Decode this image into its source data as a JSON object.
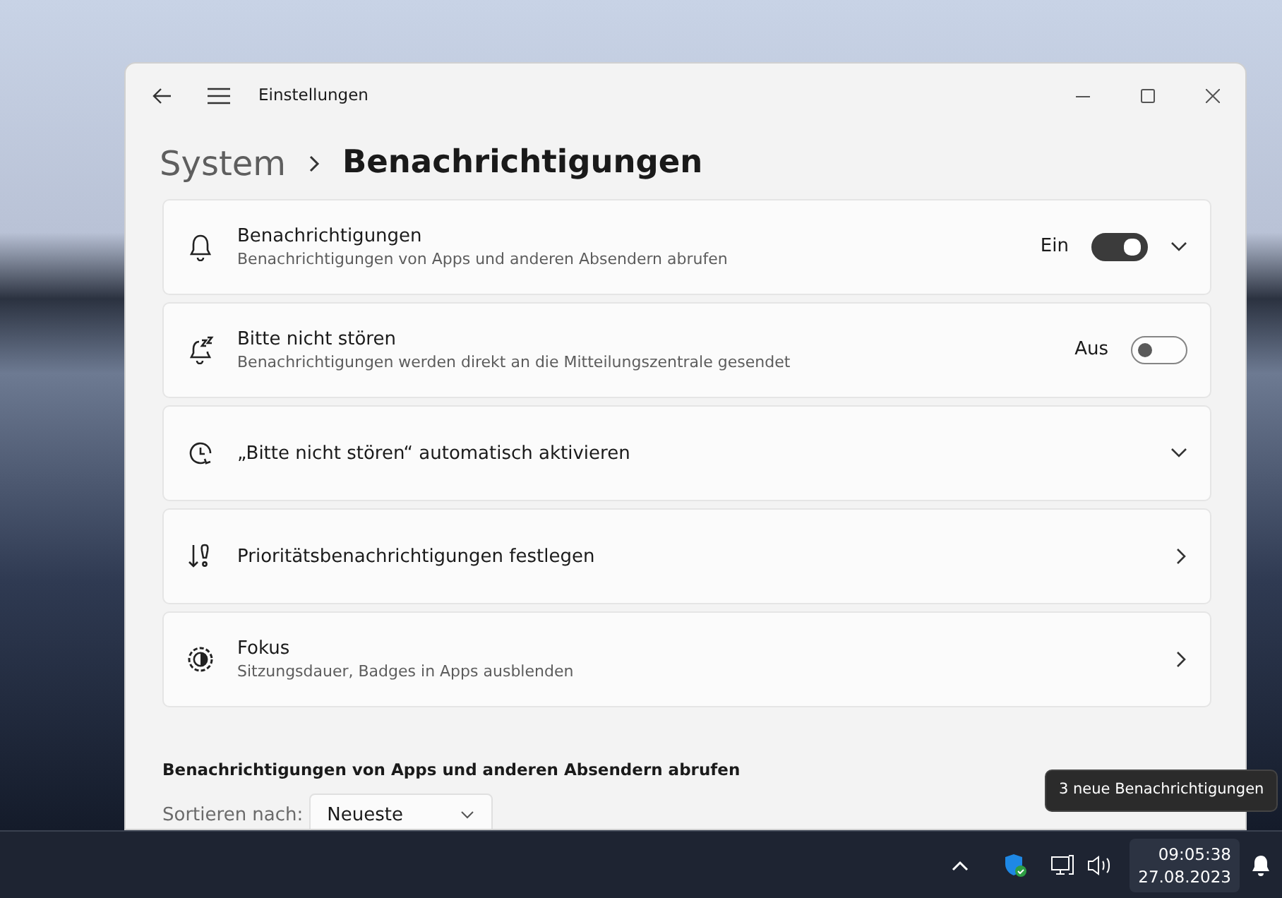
{
  "window": {
    "title": "Einstellungen"
  },
  "breadcrumb": {
    "parent": "System",
    "current": "Benachrichtigungen"
  },
  "settings": [
    {
      "kind": "toggle",
      "title": "Benachrichtigungen",
      "subtitle": "Benachrichtigungen von Apps und anderen Absendern abrufen",
      "state_label": "Ein",
      "on": true,
      "expandable": true
    },
    {
      "kind": "toggle",
      "title": "Bitte nicht stören",
      "subtitle": "Benachrichtigungen werden direkt an die Mitteilungszentrale gesendet",
      "state_label": "Aus",
      "on": false,
      "expandable": false
    },
    {
      "kind": "expand",
      "title": "„Bitte nicht stören“ automatisch aktivieren"
    },
    {
      "kind": "link",
      "title": "Prioritätsbenachrichtigungen festlegen"
    },
    {
      "kind": "link",
      "title": "Fokus",
      "subtitle": "Sitzungsdauer, Badges in Apps ausblenden"
    }
  ],
  "section": {
    "title": "Benachrichtigungen von Apps und anderen Absendern abrufen",
    "sort_label": "Sortieren nach:",
    "sort_value": "Neueste"
  },
  "tooltip": "3 neue Benachrichtigungen",
  "taskbar": {
    "time": "09:05:38",
    "date": "27.08.2023"
  }
}
